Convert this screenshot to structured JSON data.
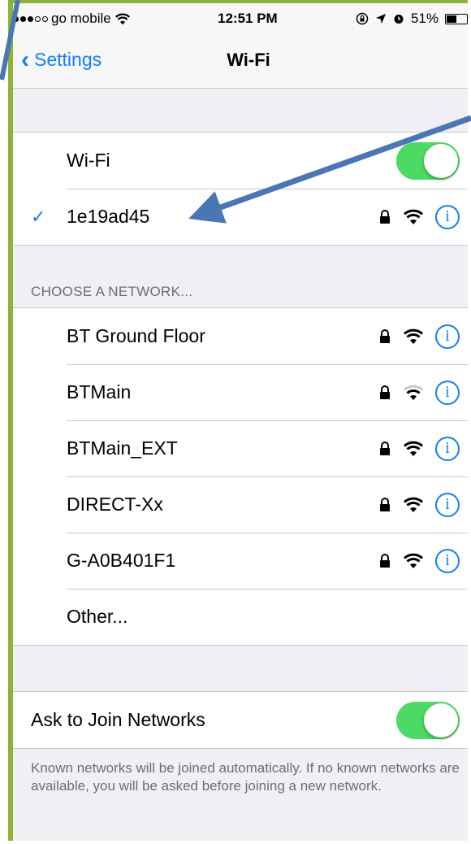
{
  "status_bar": {
    "carrier": "go mobile",
    "time": "12:51 PM",
    "battery": "51%",
    "battery_level": 0.51
  },
  "nav": {
    "back_label": "Settings",
    "title": "Wi-Fi"
  },
  "wifi_toggle": {
    "label": "Wi-Fi",
    "on": true
  },
  "connected": {
    "name": "1e19ad45"
  },
  "networks_header": "CHOOSE A NETWORK...",
  "networks": [
    {
      "name": "BT Ground Floor",
      "secured": true,
      "signal": "full"
    },
    {
      "name": "BTMain",
      "secured": true,
      "signal": "weak"
    },
    {
      "name": "BTMain_EXT",
      "secured": true,
      "signal": "full"
    },
    {
      "name": "DIRECT-Xx",
      "secured": true,
      "signal": "full"
    },
    {
      "name": "G-A0B401F1",
      "secured": true,
      "signal": "full"
    }
  ],
  "other_label": "Other...",
  "ask_to_join": {
    "label": "Ask to Join Networks",
    "on": true
  },
  "footer_text": "Known networks will be joined automatically. If no known networks are available, you will be asked before joining a new network.",
  "colors": {
    "accent": "#147efb",
    "toggle_on": "#4cd964",
    "frame": "#8DB33A",
    "annotation_arrow": "#4a77b4"
  }
}
